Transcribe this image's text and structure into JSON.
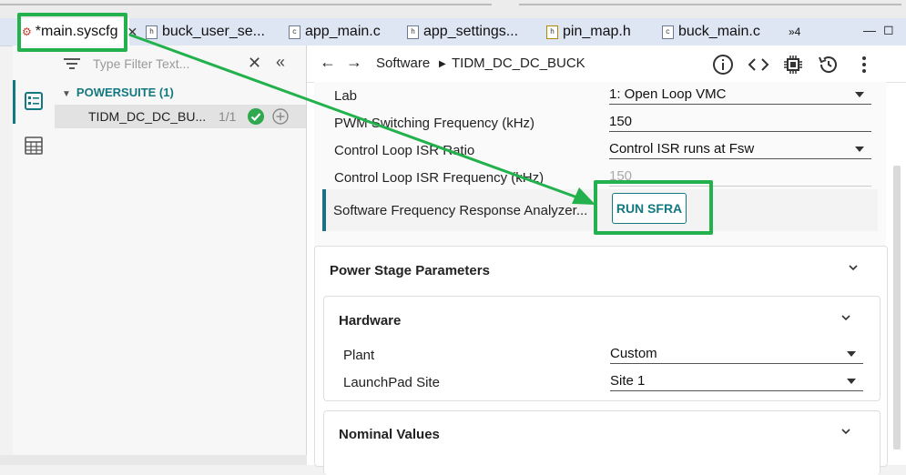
{
  "tabs": [
    {
      "label": "*main.syscfg",
      "type": "syscfg",
      "active": true
    },
    {
      "label": "buck_user_se...",
      "type": "h"
    },
    {
      "label": "app_main.c",
      "type": "c"
    },
    {
      "label": "app_settings...",
      "type": "h"
    },
    {
      "label": "pin_map.h",
      "type": "h"
    },
    {
      "label": "buck_main.c",
      "type": "c"
    }
  ],
  "tab_overflow": "»4",
  "filter": {
    "placeholder": "Type Filter Text..."
  },
  "tree": {
    "group_label": "POWERSUITE (1)",
    "item_label": "TIDM_DC_DC_BU...",
    "item_count": "1/1"
  },
  "breadcrumb": {
    "root": "Software",
    "current": "TIDM_DC_DC_BUCK"
  },
  "config": {
    "rows": [
      {
        "label": "Lab",
        "value": "1: Open Loop VMC",
        "dropdown": true
      },
      {
        "label": "PWM Switching Frequency (kHz)",
        "value": "150",
        "dropdown": false
      },
      {
        "label": "Control Loop ISR Ratio",
        "value": "Control ISR runs at Fsw",
        "dropdown": true
      },
      {
        "label": "Control Loop ISR Frequency (kHz)",
        "value": "150",
        "dropdown": false,
        "disabled": true
      }
    ],
    "sfra_label": "Software Frequency Response Analyzer...",
    "sfra_button": "RUN SFRA"
  },
  "power_stage": {
    "title": "Power Stage Parameters",
    "hardware": {
      "title": "Hardware",
      "fields": [
        {
          "label": "Plant",
          "value": "Custom"
        },
        {
          "label": "LaunchPad Site",
          "value": "Site 1"
        }
      ]
    },
    "nominal_title": "Nominal Values"
  },
  "colors": {
    "accent": "#13787f",
    "highlight": "#22b14c"
  }
}
